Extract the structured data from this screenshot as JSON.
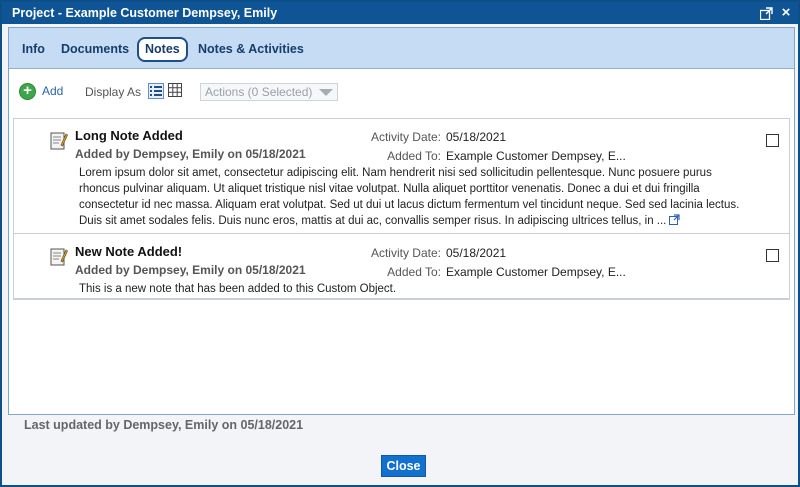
{
  "window": {
    "title": "Project - Example Customer Dempsey, Emily",
    "popout_icon": "popout-icon",
    "close_glyph": "×"
  },
  "tabs": [
    {
      "label": "Info",
      "active": false
    },
    {
      "label": "Documents",
      "active": false
    },
    {
      "label": "Notes",
      "active": true
    },
    {
      "label": "Notes & Activities",
      "active": false
    }
  ],
  "toolbar": {
    "add_label": "Add",
    "display_as_label": "Display As",
    "actions_label": "Actions (0 Selected)"
  },
  "notes": [
    {
      "title": "Long Note Added",
      "added_by": "Added by Dempsey, Emily on 05/18/2021",
      "activity_date_label": "Activity Date:",
      "activity_date": "05/18/2021",
      "added_to_label": "Added To:",
      "added_to": "Example Customer Dempsey, E...",
      "body": "Lorem ipsum dolor sit amet, consectetur adipiscing elit. Nam hendrerit nisi sed sollicitudin pellentesque. Nunc posuere purus rhoncus pulvinar aliquam. Ut aliquet tristique nisl vitae volutpat. Nulla aliquet porttitor venenatis. Donec a dui et dui fringilla consectetur id nec massa. Aliquam erat volutpat. Sed ut dui ut lacus dictum fermentum vel tincidunt neque. Sed sed lacinia lectus. Duis sit amet sodales felis. Duis nunc eros, mattis at dui ac, convallis semper risus. In adipiscing ultrices tellus, in ...",
      "checked": false
    },
    {
      "title": "New Note Added!",
      "added_by": "Added by Dempsey, Emily on 05/18/2021",
      "activity_date_label": "Activity Date:",
      "activity_date": "05/18/2021",
      "added_to_label": "Added To:",
      "added_to": "Example Customer Dempsey, E...",
      "body": "This is a new note that has been added to this Custom Object.",
      "checked": false
    }
  ],
  "footer": {
    "last_updated": "Last updated by Dempsey, Emily on 05/18/2021",
    "close_label": "Close"
  },
  "colors": {
    "titlebar": "#0f5596",
    "tabbar": "#c5dcf4",
    "add_green": "#3ea64a",
    "close_button": "#1271cf"
  }
}
